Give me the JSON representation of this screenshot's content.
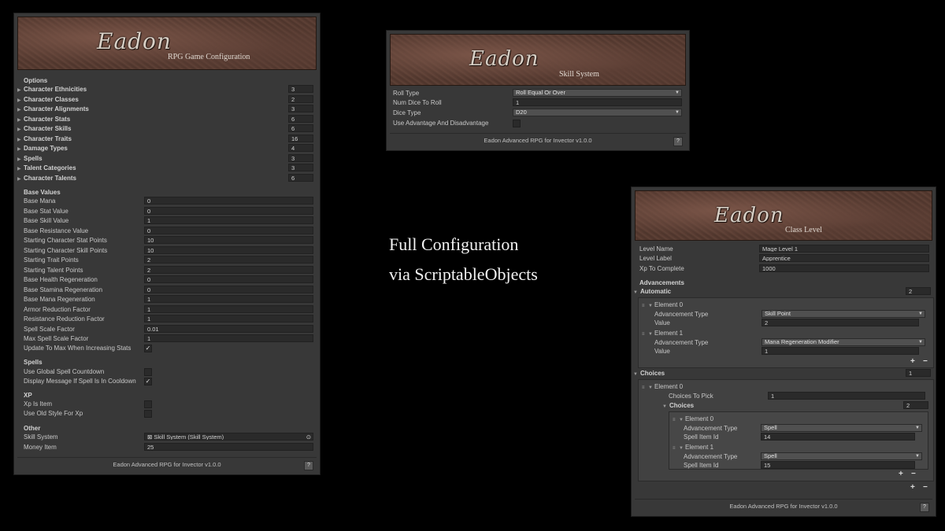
{
  "tagline": {
    "line1": "Full Configuration",
    "line2": "via ScriptableObjects"
  },
  "brand": {
    "logo": "Eadon",
    "footer": "Eadon Advanced RPG for Invector v1.0.0",
    "help": "?"
  },
  "rpg_config": {
    "subtitle": "RPG Game Configuration",
    "options_header": "Options",
    "options": [
      {
        "label": "Character Ethnicities",
        "value": "3"
      },
      {
        "label": "Character Classes",
        "value": "2"
      },
      {
        "label": "Character Alignments",
        "value": "3"
      },
      {
        "label": "Character Stats",
        "value": "6"
      },
      {
        "label": "Character Skills",
        "value": "6"
      },
      {
        "label": "Character Traits",
        "value": "16"
      },
      {
        "label": "Damage Types",
        "value": "4"
      },
      {
        "label": "Spells",
        "value": "3"
      },
      {
        "label": "Talent Categories",
        "value": "3"
      },
      {
        "label": "Character Talents",
        "value": "6"
      }
    ],
    "base_header": "Base Values",
    "base": [
      {
        "label": "Base Mana",
        "value": "0"
      },
      {
        "label": "Base Stat Value",
        "value": "0"
      },
      {
        "label": "Base Skill Value",
        "value": "1"
      },
      {
        "label": "Base Resistance Value",
        "value": "0"
      },
      {
        "label": "Starting Character Stat Points",
        "value": "10"
      },
      {
        "label": "Starting Character Skill Points",
        "value": "10"
      },
      {
        "label": "Starting Trait Points",
        "value": "2"
      },
      {
        "label": "Starting Talent Points",
        "value": "2"
      },
      {
        "label": "Base Health Regeneration",
        "value": "0"
      },
      {
        "label": "Base Stamina Regeneration",
        "value": "0"
      },
      {
        "label": "Base Mana Regeneration",
        "value": "1"
      },
      {
        "label": "Armor Reduction Factor",
        "value": "1"
      },
      {
        "label": "Resistance Reduction Factor",
        "value": "1"
      },
      {
        "label": "Spell Scale Factor",
        "value": "0.01"
      },
      {
        "label": "Max Spell Scale Factor",
        "value": "1"
      }
    ],
    "update_label": "Update To Max When Increasing Stats",
    "spells_header": "Spells",
    "global_spell": "Use Global Spell Countdown",
    "display_msg": "Display Message If Spell Is In Cooldown",
    "xp_header": "XP",
    "xp_is_item": "Xp Is Item",
    "old_style": "Use Old Style For Xp",
    "other_header": "Other",
    "skill_system_label": "Skill System",
    "skill_system_value": "Skill System (Skill System)",
    "money_label": "Money Item",
    "money_value": "25"
  },
  "skill_system": {
    "subtitle": "Skill System",
    "roll_type_label": "Roll Type",
    "roll_type_value": "Roll Equal Or Over",
    "num_dice_label": "Num Dice To Roll",
    "num_dice_value": "1",
    "dice_type_label": "Dice Type",
    "dice_type_value": "D20",
    "advantage_label": "Use Advantage And Disadvantage"
  },
  "class_level": {
    "subtitle": "Class Level",
    "level_name_label": "Level Name",
    "level_name_value": "Mage Level 1",
    "level_label_label": "Level Label",
    "level_label_value": "Apprentice",
    "xp_label": "Xp To Complete",
    "xp_value": "1000",
    "adv_header": "Advancements",
    "automatic_label": "Automatic",
    "automatic_count": "2",
    "element0": "Element 0",
    "element1": "Element 1",
    "adv_type_label": "Advancement Type",
    "value_label": "Value",
    "auto0_type": "Skill Point",
    "auto0_value": "2",
    "auto1_type": "Mana Regeneration Modifier",
    "auto1_value": "1",
    "choices_label": "Choices",
    "choices_count": "1",
    "choices_to_pick_label": "Choices To Pick",
    "choices_to_pick_value": "1",
    "inner_choices_label": "Choices",
    "inner_choices_count": "2",
    "spell_item_label": "Spell Item Id",
    "c0_type": "Spell",
    "c0_spell": "14",
    "c1_type": "Spell",
    "c1_spell": "15",
    "plus": "+",
    "minus": "−"
  }
}
